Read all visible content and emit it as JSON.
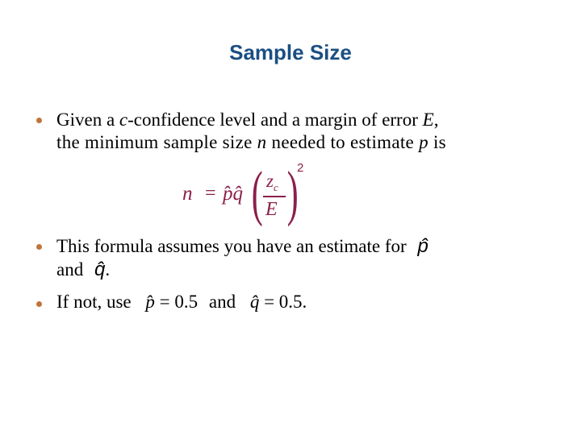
{
  "title": "Sample Size",
  "colors": {
    "title": "#1a4f83",
    "bullet": "#c0743a",
    "formula": "#8b1f4a",
    "text": "#000000"
  },
  "bullets": [
    {
      "line1_a": "Given a ",
      "line1_var_c": "c",
      "line1_b": "-confidence level and a margin of error ",
      "line1_var_E": "E",
      "line1_c": ",",
      "line2_a": "the minimum sample size ",
      "line2_var_n": "n",
      "line2_b": " needed to estimate ",
      "line2_var_p": "p",
      "line2_c": " is"
    },
    {
      "line1": "This formula assumes you have an estimate for",
      "line1_sym": "p̂",
      "line2_a": "and",
      "line2_sym": "q̂",
      "line2_b": "."
    },
    {
      "a": "If not, use",
      "p_expr_sym": "p̂",
      "p_expr_rest": " = 0.5",
      "b": "and",
      "q_expr_sym": "q̂",
      "q_expr_rest": " = 0.5."
    }
  ],
  "formula": {
    "lhs": "n",
    "eq": "=",
    "pq": "p̂q̂",
    "paren_open": "(",
    "paren_close": ")",
    "numerator": "z",
    "numerator_sub": "c",
    "denominator": "E",
    "exponent": "2"
  }
}
